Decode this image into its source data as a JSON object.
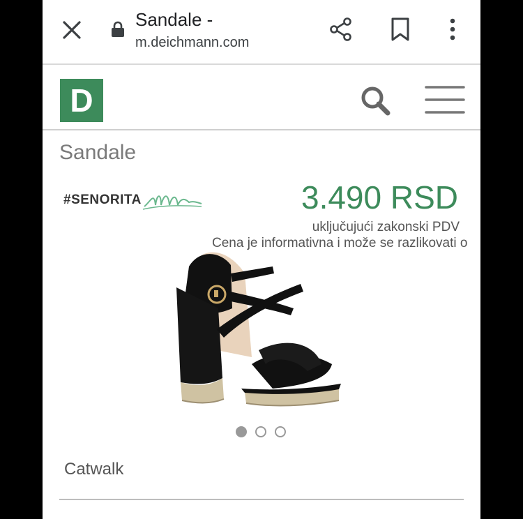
{
  "browser": {
    "page_title": "Sandale -",
    "url_host": "m.deichmann.com"
  },
  "site": {
    "logo_letter": "D",
    "brand_color": "#3d8b5b"
  },
  "product": {
    "category_title": "Sandale",
    "brand": "#SENORITA",
    "price": "3.490 RSD",
    "vat_note": "uključujući zakonski PDV",
    "disclaimer": "Cena je informativna i može se razlikovati o",
    "image_alt": "Black heeled sandal with gold platform",
    "image_slide_count": 3,
    "active_slide": 1,
    "variant": "Catwalk"
  },
  "icons": [
    "close-icon",
    "lock-icon",
    "share-icon",
    "bookmark-icon",
    "more-vert-icon",
    "search-icon",
    "menu-icon"
  ]
}
